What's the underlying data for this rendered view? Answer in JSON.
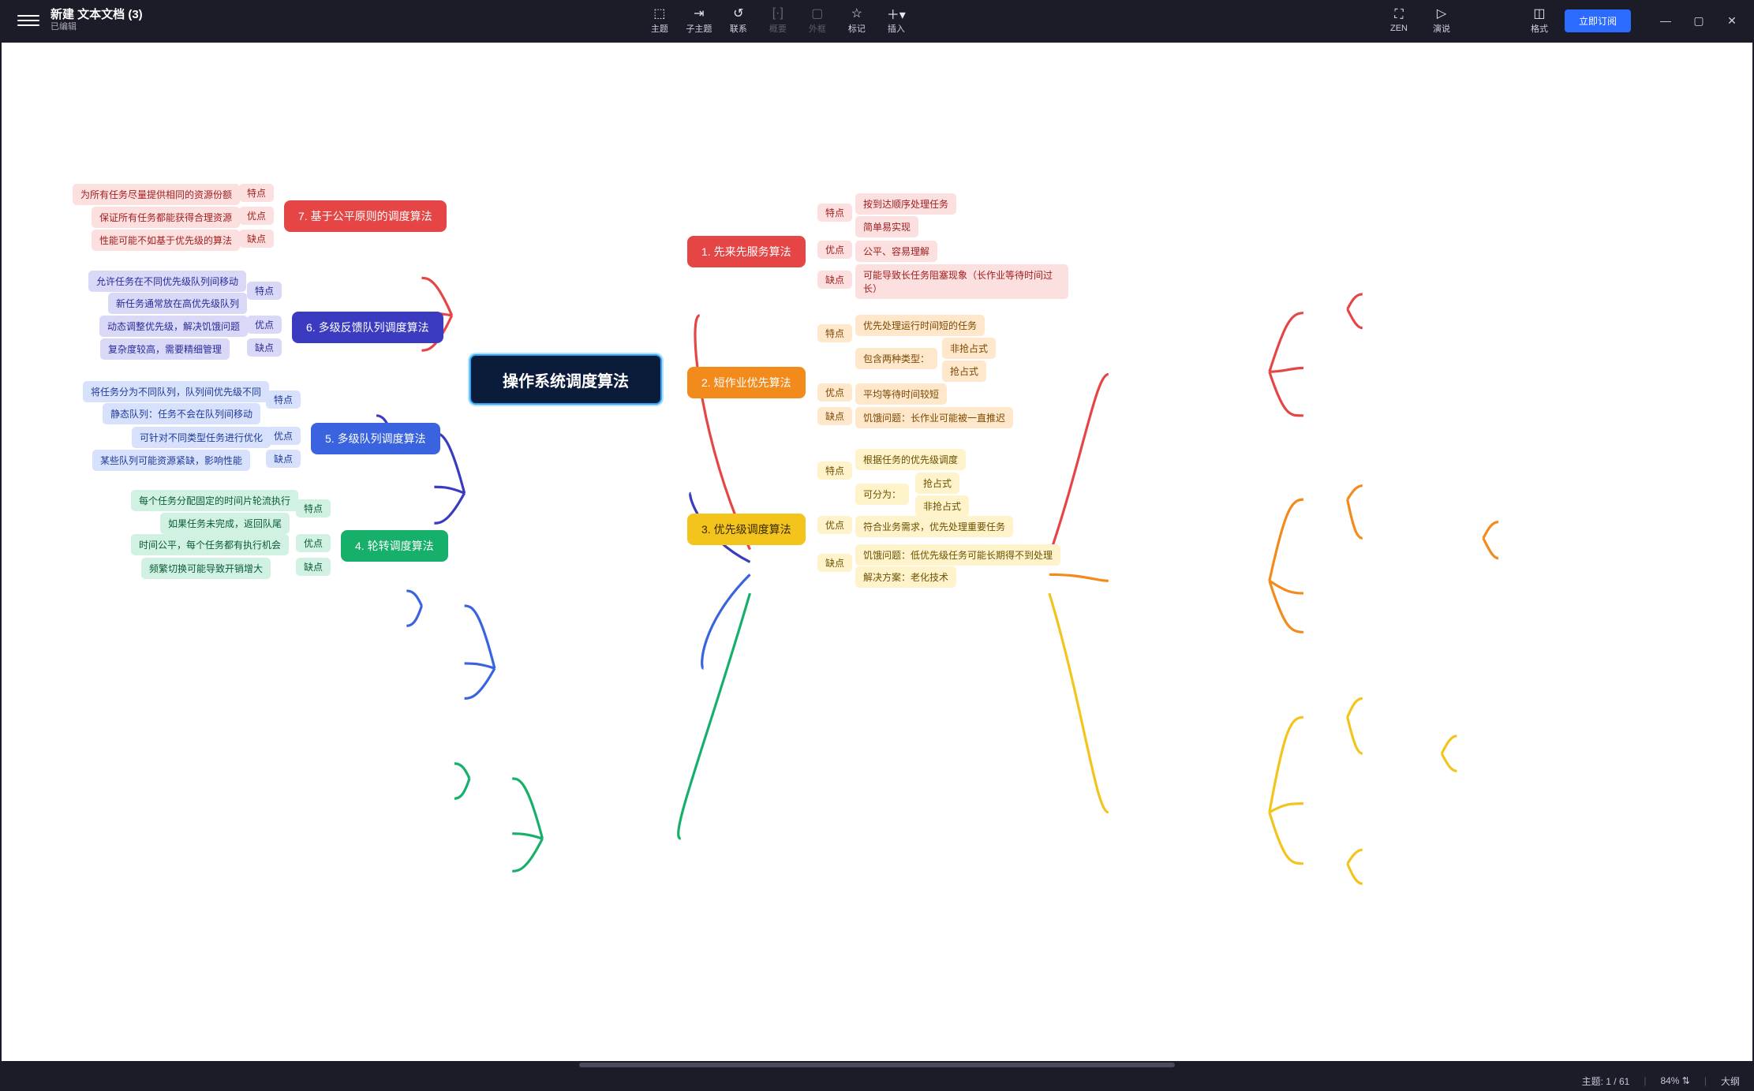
{
  "doc": {
    "title": "新建 文本文档 (3)",
    "state": "已编辑"
  },
  "toolbar": {
    "topic": "主题",
    "subtopic": "子主题",
    "relation": "联系",
    "summary": "概要",
    "boundary": "外框",
    "marker": "标记",
    "insert": "插入",
    "zen": "ZEN",
    "present": "演说",
    "format": "格式",
    "subscribe": "立即订阅"
  },
  "status": {
    "topic": "主题: 1 / 61",
    "zoom": "84%",
    "outline": "大纲"
  },
  "mindmap": {
    "central": "操作系统调度算法",
    "b1": {
      "title": "1. 先来先服务算法",
      "a": {
        "feat": "特点",
        "pro": "优点",
        "con": "缺点"
      },
      "l": {
        "f1": "按到达顺序处理任务",
        "f2": "简单易实现",
        "p1": "公平、容易理解",
        "c1": "可能导致长任务阻塞现象（长作业等待时间过长）"
      }
    },
    "b2": {
      "title": "2. 短作业优先算法",
      "a": {
        "feat": "特点",
        "pro": "优点",
        "con": "缺点"
      },
      "l": {
        "f1": "优先处理运行时间短的任务",
        "f2": "包含两种类型：",
        "f2a": "非抢占式",
        "f2b": "抢占式",
        "p1": "平均等待时间较短",
        "c1": "饥饿问题：长作业可能被一直推迟"
      }
    },
    "b3": {
      "title": "3. 优先级调度算法",
      "a": {
        "feat": "特点",
        "pro": "优点",
        "con": "缺点"
      },
      "l": {
        "f1": "根据任务的优先级调度",
        "f2": "可分为：",
        "f2a": "抢占式",
        "f2b": "非抢占式",
        "p1": "符合业务需求，优先处理重要任务",
        "c1": "饥饿问题：低优先级任务可能长期得不到处理",
        "c2": "解决方案：老化技术"
      }
    },
    "b4": {
      "title": "4. 轮转调度算法",
      "a": {
        "feat": "特点",
        "pro": "优点",
        "con": "缺点"
      },
      "l": {
        "f1": "每个任务分配固定的时间片轮流执行",
        "f2": "如果任务未完成，返回队尾",
        "p1": "时间公平，每个任务都有执行机会",
        "c1": "频繁切换可能导致开销增大"
      }
    },
    "b5": {
      "title": "5. 多级队列调度算法",
      "a": {
        "feat": "特点",
        "pro": "优点",
        "con": "缺点"
      },
      "l": {
        "f1": "将任务分为不同队列，队列间优先级不同",
        "f2": "静态队列：任务不会在队列间移动",
        "p1": "可针对不同类型任务进行优化",
        "c1": "某些队列可能资源紧缺，影响性能"
      }
    },
    "b6": {
      "title": "6. 多级反馈队列调度算法",
      "a": {
        "feat": "特点",
        "pro": "优点",
        "con": "缺点"
      },
      "l": {
        "f1": "允许任务在不同优先级队列间移动",
        "f2": "新任务通常放在高优先级队列",
        "p1": "动态调整优先级，解决饥饿问题",
        "c1": "复杂度较高，需要精细管理"
      }
    },
    "b7": {
      "title": "7. 基于公平原则的调度算法",
      "a": {
        "feat": "特点",
        "pro": "优点",
        "con": "缺点"
      },
      "l": {
        "f1": "为所有任务尽量提供相同的资源份额",
        "p1": "保证所有任务都能获得合理资源",
        "c1": "性能可能不如基于优先级的算法"
      }
    }
  }
}
